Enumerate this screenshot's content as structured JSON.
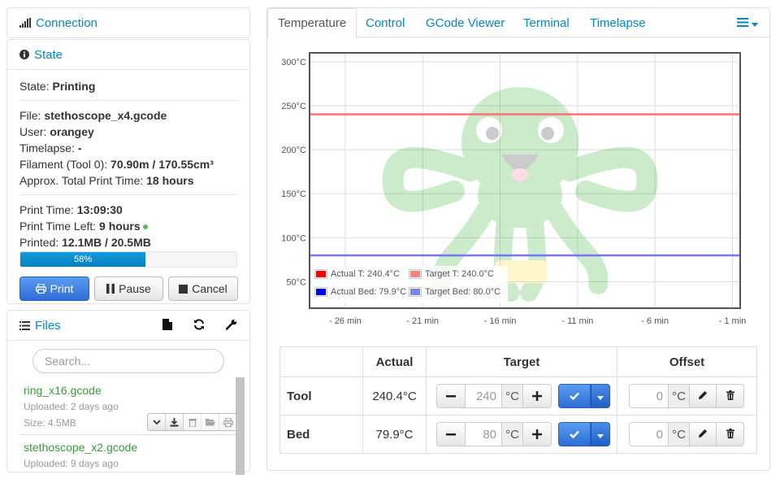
{
  "sidebar": {
    "connection": {
      "title": "Connection"
    },
    "state": {
      "title": "State",
      "status_label": "State:",
      "status": "Printing",
      "file_label": "File:",
      "file": "stethoscope_x4.gcode",
      "user_label": "User:",
      "user": "orangey",
      "timelapse_label": "Timelapse:",
      "timelapse": "-",
      "filament_label": "Filament (Tool 0):",
      "filament": "70.90m / 170.55cm³",
      "approx_label": "Approx. Total Print Time:",
      "approx": "18 hours",
      "print_time_label": "Print Time:",
      "print_time": "13:09:30",
      "time_left_label": "Print Time Left:",
      "time_left": "9 hours",
      "printed_label": "Printed:",
      "printed": "12.1MB / 20.5MB",
      "progress_percent": 58,
      "progress_text": "58%",
      "buttons": {
        "print": "Print",
        "pause": "Pause",
        "cancel": "Cancel"
      }
    },
    "files": {
      "title": "Files",
      "search_placeholder": "Search...",
      "items": [
        {
          "name": "ring_x16.gcode",
          "uploaded": "Uploaded: 2 days ago",
          "size": "Size: 4.5MB"
        },
        {
          "name": "stethoscope_x2.gcode",
          "uploaded": "Uploaded: 9 days ago",
          "size": ""
        }
      ]
    }
  },
  "tabs": [
    {
      "label": "Temperature",
      "active": true
    },
    {
      "label": "Control"
    },
    {
      "label": "GCode Viewer"
    },
    {
      "label": "Terminal"
    },
    {
      "label": "Timelapse"
    }
  ],
  "colors": {
    "actual_tool": "#ff0000",
    "target_tool": "#ff8080",
    "actual_bed": "#0000ff",
    "target_bed": "#8080ff",
    "accent": "#0088cc"
  },
  "chart_data": {
    "type": "line",
    "x_unit": "min",
    "xlim": [
      -28.3,
      -0.5
    ],
    "ylim": [
      20,
      310
    ],
    "x_ticks": [
      -26,
      -21,
      -16,
      -11,
      -6,
      -1
    ],
    "x_tick_labels": [
      "- 26 min",
      "- 21 min",
      "- 16 min",
      "- 11 min",
      "- 6 min",
      "- 1 min"
    ],
    "y_ticks": [
      50,
      100,
      150,
      200,
      250,
      300
    ],
    "y_tick_labels": [
      "50°C",
      "100°C",
      "150°C",
      "200°C",
      "250°C",
      "300°C"
    ],
    "grid": true,
    "legend_position": "bottom-left",
    "series": [
      {
        "name": "Actual T: 240.4°C",
        "color": "#ff0000",
        "x": [
          -28.3,
          -0.5
        ],
        "y": [
          240.4,
          240.4
        ]
      },
      {
        "name": "Target T: 240.0°C",
        "color": "#ff8080",
        "x": [
          -28.3,
          -0.5
        ],
        "y": [
          240.0,
          240.0
        ]
      },
      {
        "name": "Actual Bed: 79.9°C",
        "color": "#0000ff",
        "x": [
          -28.3,
          -0.5
        ],
        "y": [
          79.9,
          79.9
        ]
      },
      {
        "name": "Target Bed: 80.0°C",
        "color": "#8080ff",
        "x": [
          -28.3,
          -0.5
        ],
        "y": [
          80.0,
          80.0
        ]
      }
    ]
  },
  "temperature_table": {
    "headers": [
      "",
      "Actual",
      "Target",
      "Offset"
    ],
    "unit": "°C",
    "rows": [
      {
        "label": "Tool",
        "actual": "240.4°C",
        "target_value": "240",
        "offset_value": "0"
      },
      {
        "label": "Bed",
        "actual": "79.9°C",
        "target_value": "80",
        "offset_value": "0"
      }
    ]
  }
}
